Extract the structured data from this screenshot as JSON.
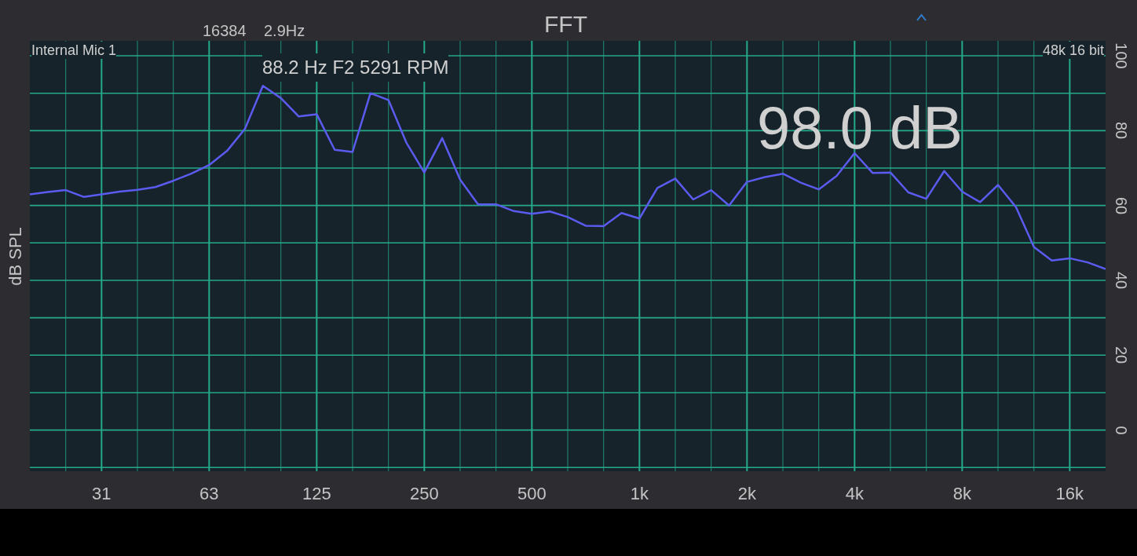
{
  "header": {
    "fft_size": "16384",
    "resolution": "2.9Hz",
    "title": "FFT"
  },
  "plot": {
    "input": "Internal Mic 1",
    "format": "48k 16 bit",
    "peak": "88.2 Hz F2 5291 RPM",
    "level": "98.0 dB",
    "chart_data": {
      "type": "line",
      "grid": true,
      "ylabel": "dB SPL",
      "ylim": [
        -11,
        104
      ],
      "yticks": [
        0,
        20,
        40,
        60,
        80,
        100
      ],
      "categories": [
        null,
        null,
        null,
        null,
        "31",
        null,
        null,
        null,
        null,
        null,
        "63",
        null,
        null,
        null,
        null,
        null,
        "125",
        null,
        null,
        null,
        null,
        null,
        "250",
        null,
        null,
        null,
        null,
        null,
        "500",
        null,
        null,
        null,
        null,
        null,
        "1k",
        null,
        null,
        null,
        null,
        null,
        "2k",
        null,
        null,
        null,
        null,
        null,
        "4k",
        null,
        null,
        null,
        null,
        null,
        "8k",
        null,
        null,
        null,
        null,
        null,
        "16k",
        null,
        null
      ],
      "series": [
        {
          "color": "#5b5bf0",
          "values": [
            63,
            63.6,
            64.1,
            62.3,
            63,
            63.7,
            64.2,
            64.9,
            66.6,
            68.5,
            70.8,
            74.6,
            80.5,
            92,
            88.7,
            83.8,
            84.4,
            74.9,
            74.3,
            90,
            88.2,
            76.8,
            68.8,
            78,
            66.9,
            60.3,
            60.3,
            58.5,
            57.8,
            58.4,
            56.9,
            54.6,
            54.5,
            58,
            56.5,
            64.7,
            67.2,
            61.6,
            64.1,
            60,
            66.3,
            67.6,
            68.5,
            66.1,
            64.3,
            67.9,
            74,
            68.7,
            68.8,
            63.5,
            61.8,
            69.2,
            63.7,
            60.9,
            65.5,
            59.6,
            48.9,
            45.3,
            45.9,
            44.8,
            43
          ]
        }
      ]
    }
  }
}
